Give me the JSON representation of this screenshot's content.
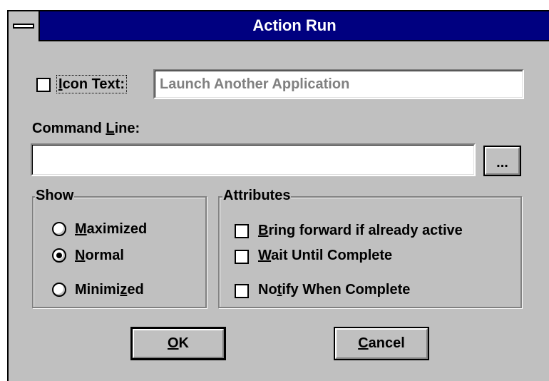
{
  "window": {
    "title": "Action Run"
  },
  "icon_text": {
    "label_before": "",
    "label_mnemonic": "I",
    "label_after": "con Text:",
    "checked": false,
    "value": "Launch Another Application"
  },
  "command_line": {
    "label_before": "Command ",
    "label_mnemonic": "L",
    "label_after": "ine:",
    "value": "",
    "browse_label": "..."
  },
  "show": {
    "legend": "Show",
    "options": [
      {
        "before": "",
        "mnemonic": "M",
        "after": "aximized",
        "selected": false
      },
      {
        "before": "",
        "mnemonic": "N",
        "after": "ormal",
        "selected": true
      },
      {
        "before": "Minimi",
        "mnemonic": "z",
        "after": "ed",
        "selected": false
      }
    ]
  },
  "attributes": {
    "legend": "Attributes",
    "options": [
      {
        "before": "",
        "mnemonic": "B",
        "after": "ring forward if already active",
        "checked": false
      },
      {
        "before": "",
        "mnemonic": "W",
        "after": "ait Until Complete",
        "checked": false
      },
      {
        "before": "No",
        "mnemonic": "t",
        "after": "ify When Complete",
        "checked": false
      }
    ]
  },
  "buttons": {
    "ok": {
      "before": "",
      "mnemonic": "O",
      "after": "K"
    },
    "cancel": {
      "before": "",
      "mnemonic": "C",
      "after": "ancel"
    }
  }
}
